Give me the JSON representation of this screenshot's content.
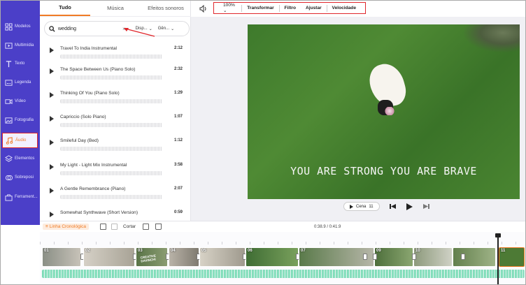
{
  "sidebar": {
    "items": [
      {
        "label": "Modelos",
        "icon": "templates-icon"
      },
      {
        "label": "Multimídia",
        "icon": "media-icon"
      },
      {
        "label": "Texto",
        "icon": "text-icon"
      },
      {
        "label": "Legenda",
        "icon": "subtitle-icon"
      },
      {
        "label": "Vídeo",
        "icon": "video-icon"
      },
      {
        "label": "Fotografia",
        "icon": "photo-icon"
      },
      {
        "label": "Áudio",
        "icon": "music-icon"
      },
      {
        "label": "Elementos",
        "icon": "elements-icon"
      },
      {
        "label": "Sobreposi",
        "icon": "overlay-icon"
      },
      {
        "label": "Ferrament...",
        "icon": "tools-icon"
      }
    ],
    "active_index": 6,
    "accent": "#f07b25",
    "bg": "#4b3fc8"
  },
  "panel": {
    "tabs": [
      "Tudo",
      "Música",
      "Efeitos sonoros"
    ],
    "active_tab": 0,
    "search": {
      "value": "wedding",
      "dropdown1": "Disp...",
      "dropdown2": "Gên..."
    },
    "tracks": [
      {
        "title": "Travel To India Instrumental",
        "duration": "2:12"
      },
      {
        "title": "The Space Between Us (Piano Solo)",
        "duration": "2:32"
      },
      {
        "title": "Thinking Of You (Piano Solo)",
        "duration": "1:29"
      },
      {
        "title": "Capriccio (Solo Piano)",
        "duration": "1:07"
      },
      {
        "title": "Smileful Day (Bed)",
        "duration": "1:12"
      },
      {
        "title": "My Light - Light Mix Instrumental",
        "duration": "3:58"
      },
      {
        "title": "A Gentle Remembrance (Piano)",
        "duration": "2:07"
      },
      {
        "title": "Somewhat Synthwave (Short Version)",
        "duration": "0:59"
      }
    ]
  },
  "toolbar": {
    "zoom": "100%",
    "transform": "Transformar",
    "filter": "Filtro",
    "adjust": "Ajustar",
    "speed": "Velocidade"
  },
  "preview": {
    "caption": "YOU ARE STRONG YOU ARE BRAVE",
    "scene_label": "Cena",
    "scene_number": "11"
  },
  "timeline": {
    "mode_label": "Linha Cronológica",
    "cut_label": "Cortar",
    "timecode": "0:38.9 / 0:41.9",
    "clips": [
      "01",
      "02",
      "03",
      "04",
      "05",
      "06",
      "07",
      "08",
      "09",
      "10",
      "11"
    ],
    "clip_03_overlay": "CREATIVE DAVINCHI"
  }
}
